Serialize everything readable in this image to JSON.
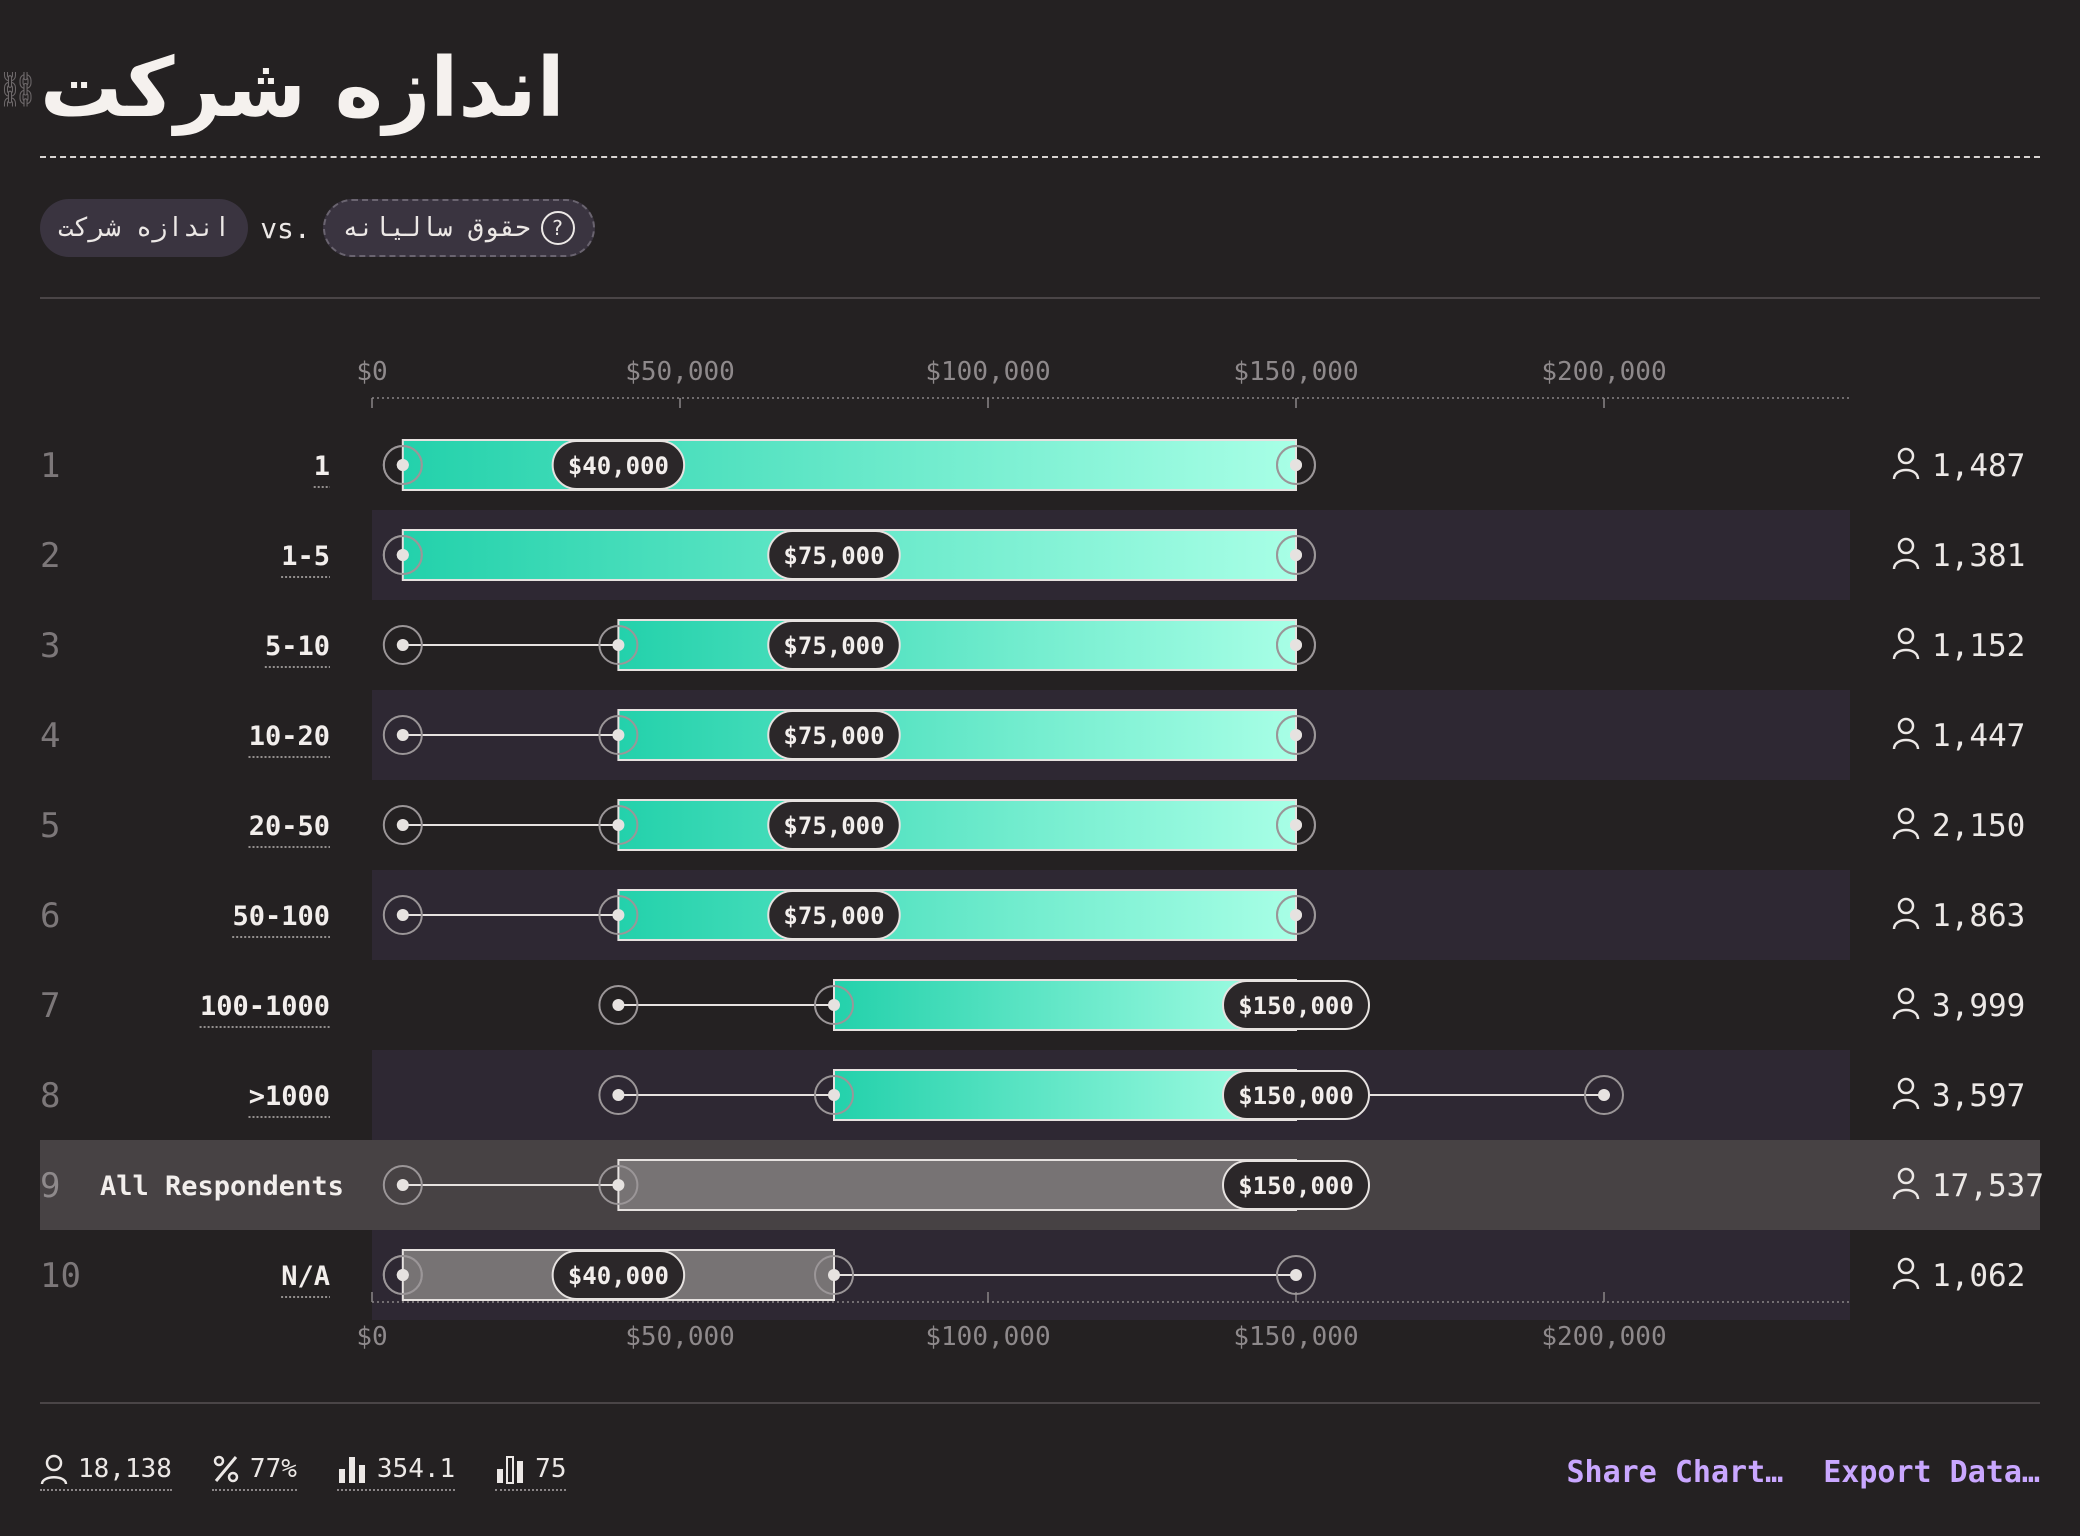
{
  "title": "اندازه شرکت",
  "selectors": {
    "left": "اندازه شرکت",
    "vs": "vs.",
    "right": "حقوق سالیانه"
  },
  "colors": {
    "background": "#242122",
    "bar_start": "#23d1ab",
    "bar_end": "#a8ffe6",
    "band": "#2e2833",
    "highlight": "#474244",
    "accent": "#c9a7ff"
  },
  "chart_data": {
    "type": "box",
    "xlim": [
      0,
      240000
    ],
    "ticks": [
      0,
      50000,
      100000,
      150000,
      200000
    ],
    "tick_labels": [
      "$0",
      "$50,000",
      "$100,000",
      "$150,000",
      "$200,000"
    ],
    "rows": [
      {
        "rank": "1",
        "label": "1",
        "min": 5000,
        "q1": 5000,
        "median": 40000,
        "q3": 150000,
        "max": 150000,
        "median_label": "$40,000",
        "count": "1,487",
        "variant": "normal"
      },
      {
        "rank": "2",
        "label": "1-5",
        "min": 5000,
        "q1": 5000,
        "median": 75000,
        "q3": 150000,
        "max": 150000,
        "median_label": "$75,000",
        "count": "1,381",
        "variant": "normal"
      },
      {
        "rank": "3",
        "label": "5-10",
        "min": 5000,
        "q1": 40000,
        "median": 75000,
        "q3": 150000,
        "max": 150000,
        "median_label": "$75,000",
        "count": "1,152",
        "variant": "normal"
      },
      {
        "rank": "4",
        "label": "10-20",
        "min": 5000,
        "q1": 40000,
        "median": 75000,
        "q3": 150000,
        "max": 150000,
        "median_label": "$75,000",
        "count": "1,447",
        "variant": "normal"
      },
      {
        "rank": "5",
        "label": "20-50",
        "min": 5000,
        "q1": 40000,
        "median": 75000,
        "q3": 150000,
        "max": 150000,
        "median_label": "$75,000",
        "count": "2,150",
        "variant": "normal"
      },
      {
        "rank": "6",
        "label": "50-100",
        "min": 5000,
        "q1": 40000,
        "median": 75000,
        "q3": 150000,
        "max": 150000,
        "median_label": "$75,000",
        "count": "1,863",
        "variant": "normal"
      },
      {
        "rank": "7",
        "label": "100-1000",
        "min": 40000,
        "q1": 75000,
        "median": 150000,
        "q3": 150000,
        "max": 150000,
        "median_label": "$150,000",
        "count": "3,999",
        "variant": "normal"
      },
      {
        "rank": "8",
        "label": ">1000",
        "min": 40000,
        "q1": 75000,
        "median": 150000,
        "q3": 150000,
        "max": 200000,
        "median_label": "$150,000",
        "count": "3,597",
        "variant": "normal"
      },
      {
        "rank": "9",
        "label": "All Respondents",
        "min": 5000,
        "q1": 40000,
        "median": 150000,
        "q3": 150000,
        "max": 150000,
        "median_label": "$150,000",
        "count": "17,537",
        "variant": "all"
      },
      {
        "rank": "10",
        "label": "N/A",
        "min": 5000,
        "q1": 5000,
        "median": 40000,
        "q3": 75000,
        "max": 150000,
        "median_label": "$40,000",
        "count": "1,062",
        "variant": "na"
      }
    ]
  },
  "footer": {
    "stats": [
      {
        "icon": "person-icon",
        "value": "18,138"
      },
      {
        "icon": "percent-icon",
        "value": "77%"
      },
      {
        "icon": "bar-chart-icon",
        "value": "354.1"
      },
      {
        "icon": "bar-chart-outline-icon",
        "value": "75"
      }
    ],
    "share_label": "Share Chart…",
    "export_label": "Export Data…"
  }
}
